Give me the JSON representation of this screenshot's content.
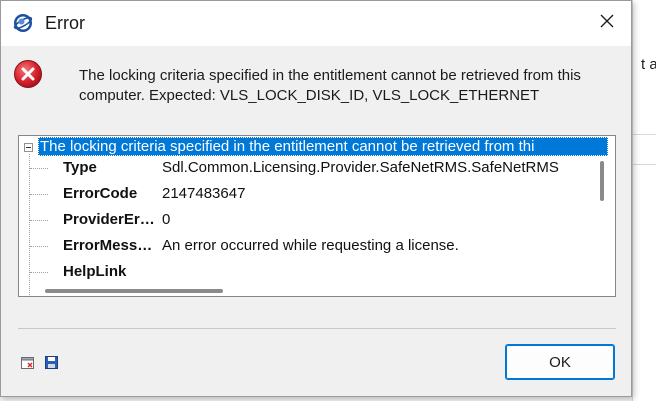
{
  "background": {
    "peek_text": "t an"
  },
  "dialog": {
    "title": "Error",
    "title_icon": "app-globe-icon",
    "close_icon": "close-icon",
    "error_icon": "error-circle-x-icon",
    "message": "The locking criteria specified in the entitlement cannot be retrieved from this computer. Expected: VLS_LOCK_DISK_ID, VLS_LOCK_ETHERNET",
    "details": {
      "root_label": "The locking criteria specified in the entitlement cannot be retrieved from thi",
      "rows": [
        {
          "key": "Type",
          "value": "Sdl.Common.Licensing.Provider.SafeNetRMS.SafeNetRMS"
        },
        {
          "key": "ErrorCode",
          "value": "2147483647"
        },
        {
          "key": "ProviderEr…",
          "value": "0"
        },
        {
          "key": "ErrorMess…",
          "value": "An error occurred while requesting a license."
        },
        {
          "key": "HelpLink",
          "value": ""
        }
      ]
    },
    "footer": {
      "copy_icon": "window-copy-icon",
      "save_icon": "save-disk-icon",
      "ok_label": "OK"
    },
    "colors": {
      "selection": "#0078d7",
      "error_red": "#d9232e"
    }
  }
}
